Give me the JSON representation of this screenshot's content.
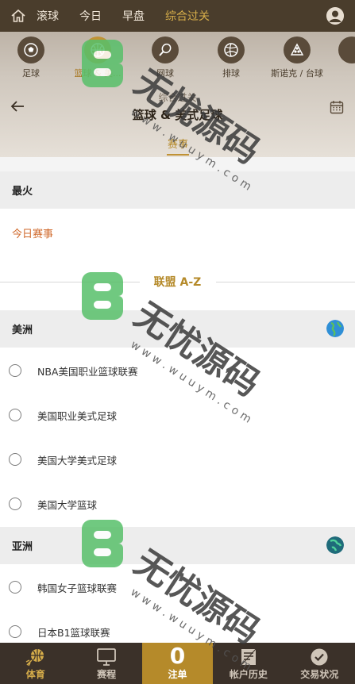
{
  "topnav": {
    "tabs": [
      {
        "label": "滚球",
        "active": false
      },
      {
        "label": "今日",
        "active": false
      },
      {
        "label": "早盘",
        "active": false
      },
      {
        "label": "综合过关",
        "active": true
      }
    ]
  },
  "sports": [
    {
      "label": "足球",
      "icon": "soccer-ball-icon",
      "active": false
    },
    {
      "label": "篮球 & 美...",
      "icon": "basketball-icon",
      "active": true
    },
    {
      "label": "网球",
      "icon": "tennis-racket-icon",
      "active": false
    },
    {
      "label": "排球",
      "icon": "volleyball-icon",
      "active": false
    },
    {
      "label": "斯诺克 / 台球",
      "icon": "snooker-icon",
      "active": false
    }
  ],
  "header": {
    "subtitle": "综合过关",
    "title": "篮球 & 美式足球",
    "tab": "赛事"
  },
  "hot": {
    "heading": "最火",
    "today_link": "今日赛事"
  },
  "league_az": "联盟 A-Z",
  "regions": [
    {
      "name": "美洲",
      "globe_color": "#2f8fd6",
      "leagues": [
        "NBA美国职业篮球联赛",
        "美国职业美式足球",
        "美国大学美式足球",
        "美国大学篮球"
      ]
    },
    {
      "name": "亚洲",
      "globe_color": "#1f6b7a",
      "leagues": [
        "韩国女子篮球联赛",
        "日本B1篮球联赛"
      ]
    }
  ],
  "bottom": [
    {
      "label": "体育",
      "icon": "sports-icon",
      "active": true
    },
    {
      "label": "赛程",
      "icon": "monitor-icon",
      "active": false
    },
    {
      "label": "注单",
      "count": "0",
      "active": false
    },
    {
      "label": "帐户历史",
      "icon": "history-icon",
      "active": false
    },
    {
      "label": "交易状况",
      "icon": "check-circle-icon",
      "active": false
    }
  ],
  "watermark": {
    "text": "无忧源码",
    "url": "w w w . w u u y m . c o m"
  }
}
